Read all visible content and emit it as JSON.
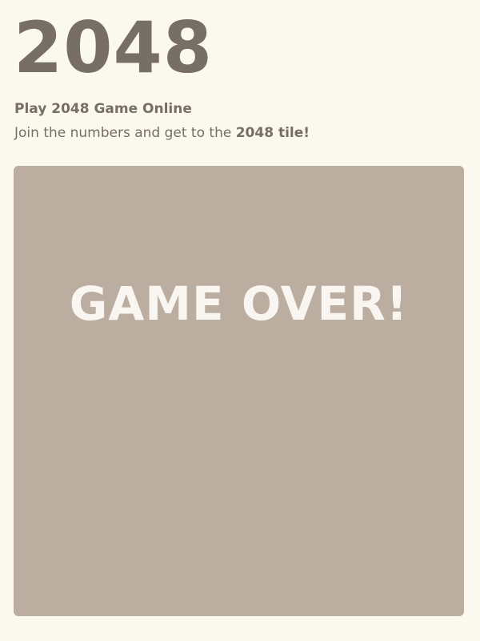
{
  "header": {
    "title": "2048",
    "subtitle": "Play 2048 Game Online",
    "tagline_prefix": "Join the numbers and get to the ",
    "tagline_bold": "2048 tile!"
  },
  "board": {
    "message": "GAME OVER!"
  },
  "colors": {
    "background": "#faf8ef",
    "text": "#776e65",
    "board": "#bbada0",
    "message": "#f9f6f2"
  }
}
